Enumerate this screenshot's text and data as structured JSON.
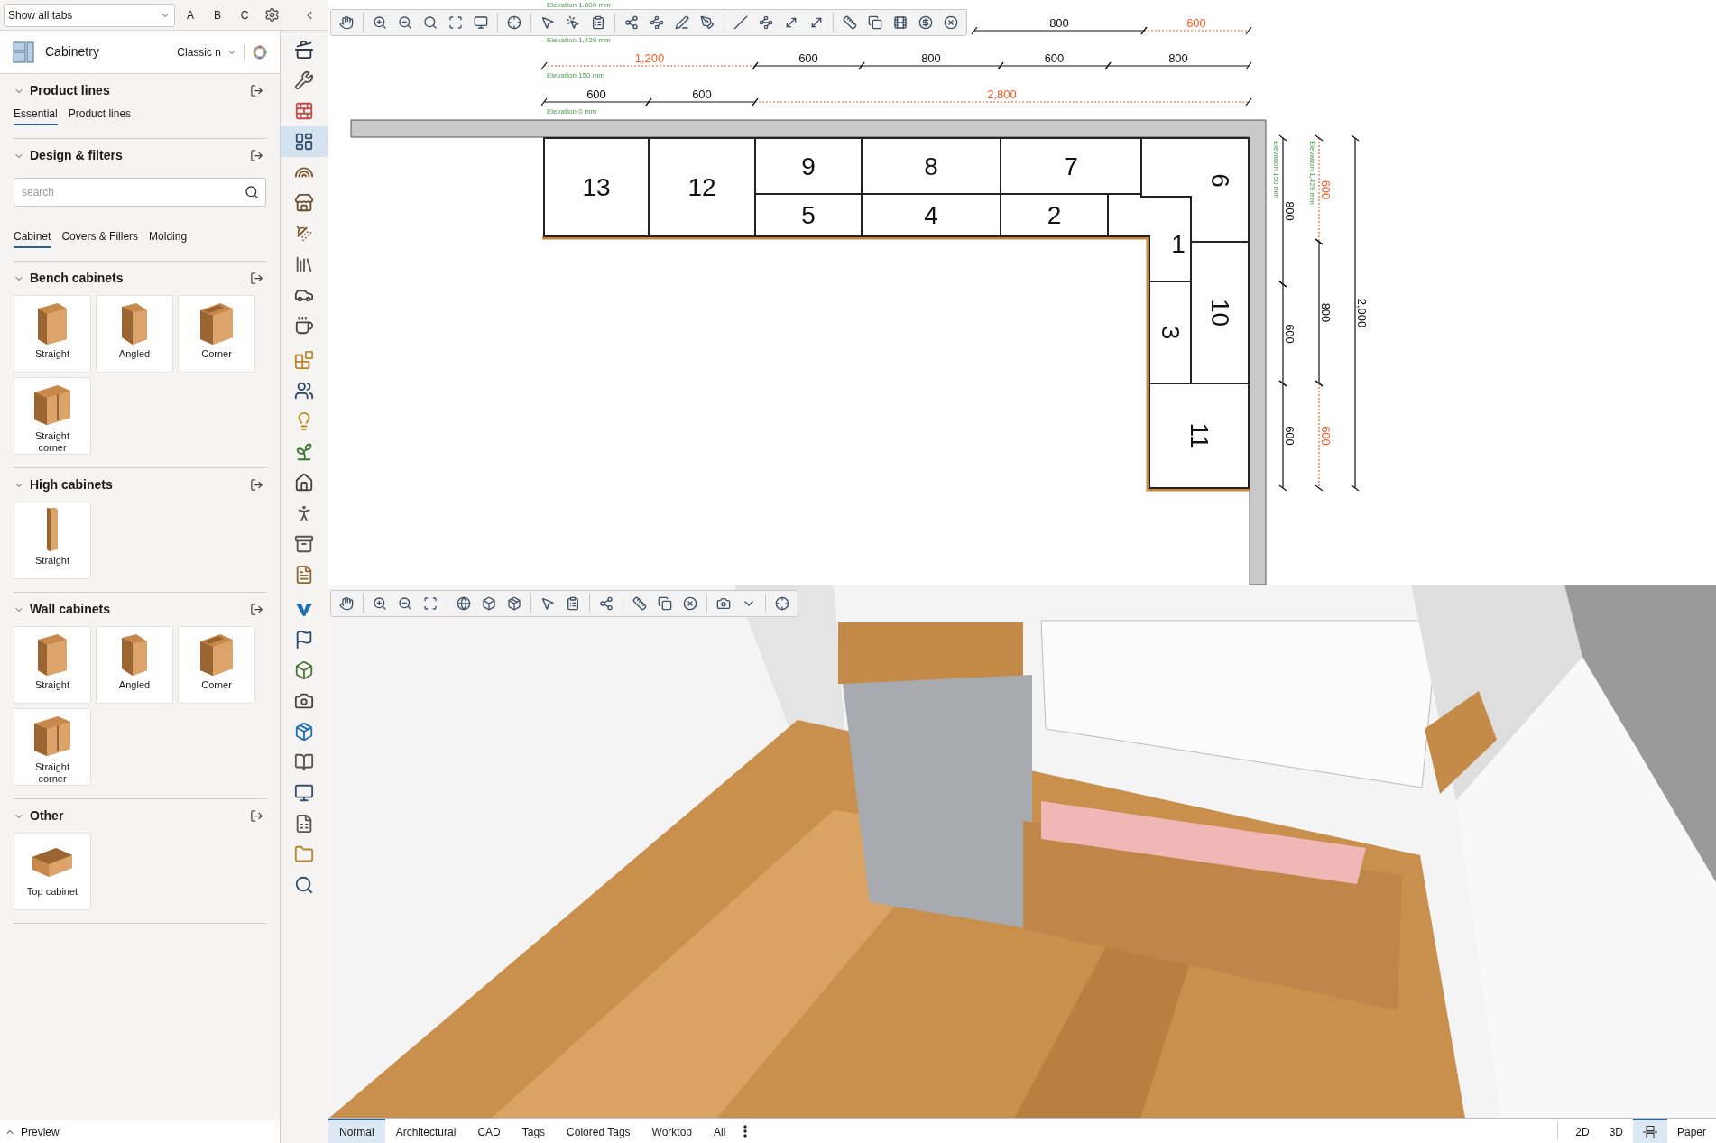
{
  "top_bar": {
    "tab_filter": "Show all tabs",
    "letters": [
      "A",
      "B",
      "C"
    ]
  },
  "catalog": {
    "title": "Cabinetry",
    "style": "Classic n"
  },
  "sections": [
    {
      "title": "Product lines",
      "expanded": true,
      "tabs": [
        {
          "label": "Essential",
          "selected": true
        },
        {
          "label": "Product lines",
          "selected": false
        }
      ]
    },
    {
      "title": "Design & filters",
      "expanded": true,
      "search": {
        "placeholder": "search"
      },
      "tabs": [
        {
          "label": "Cabinet",
          "selected": true
        },
        {
          "label": "Covers & Fillers",
          "selected": false
        },
        {
          "label": "Molding",
          "selected": false
        }
      ]
    },
    {
      "title": "Bench cabinets",
      "expanded": true,
      "items": [
        {
          "label": "Straight",
          "kind": "straight"
        },
        {
          "label": "Angled",
          "kind": "angled"
        },
        {
          "label": "Corner",
          "kind": "corner"
        },
        {
          "label": "Straight corner",
          "kind": "straight_corner"
        }
      ]
    },
    {
      "title": "High cabinets",
      "expanded": true,
      "items": [
        {
          "label": "Straight",
          "kind": "tall"
        }
      ]
    },
    {
      "title": "Wall cabinets",
      "expanded": true,
      "items": [
        {
          "label": "Straight",
          "kind": "straight"
        },
        {
          "label": "Angled",
          "kind": "angled"
        },
        {
          "label": "Corner",
          "kind": "corner"
        },
        {
          "label": "Straight corner",
          "kind": "straight_corner"
        }
      ]
    },
    {
      "title": "Other",
      "expanded": true,
      "items": [
        {
          "label": "Top cabinet",
          "kind": "top"
        }
      ]
    }
  ],
  "preview": {
    "label": "Preview",
    "expanded": false
  },
  "tools": [
    {
      "selected": false
    },
    {
      "selected": false
    },
    {
      "selected": false
    },
    {
      "selected": true
    },
    {
      "selected": false
    },
    {
      "selected": false
    },
    {
      "selected": false
    },
    {
      "selected": false
    },
    {
      "selected": false
    },
    {
      "selected": false
    },
    {
      "selected": false
    },
    {
      "selected": false
    },
    {
      "selected": false
    },
    {
      "selected": false
    },
    {
      "selected": false
    },
    {
      "selected": false
    },
    {
      "selected": false
    },
    {
      "selected": false
    },
    {
      "selected": false
    },
    {
      "selected": false
    },
    {
      "selected": false
    },
    {
      "selected": false
    },
    {
      "selected": false
    },
    {
      "selected": false
    },
    {
      "selected": false
    },
    {
      "selected": false
    },
    {
      "selected": false
    },
    {
      "selected": false
    }
  ],
  "plan": {
    "top_elevation": "Elevation 1,800 mm",
    "dimension_rows": [
      {
        "elevation": "Elevation 1,429 mm",
        "segments": [
          {
            "label": "800",
            "highlighted": false
          },
          {
            "label": "600",
            "highlighted": true
          }
        ]
      },
      {
        "elevation": "Elevation 150 mm",
        "segments": [
          {
            "label": "1,200",
            "highlighted": true
          },
          {
            "label": "600",
            "highlighted": false
          },
          {
            "label": "800",
            "highlighted": false
          },
          {
            "label": "600",
            "highlighted": false
          },
          {
            "label": "800",
            "highlighted": false
          }
        ]
      },
      {
        "elevation": "Elevation 0 mm",
        "segments": [
          {
            "label": "600",
            "highlighted": false
          },
          {
            "label": "600",
            "highlighted": false
          },
          {
            "label": "2,800",
            "highlighted": true
          }
        ]
      }
    ],
    "vertical_dimensions": [
      {
        "elevation": "Elevation 150 mm",
        "segments": [
          {
            "label": "800",
            "highlighted": false
          },
          {
            "label": "600",
            "highlighted": false
          },
          {
            "label": "600",
            "highlighted": false
          }
        ]
      },
      {
        "elevation": "Elevation 1,429 mm",
        "segments": [
          {
            "label": "600",
            "highlighted": true
          },
          {
            "label": "800",
            "highlighted": false
          },
          {
            "label": "600",
            "highlighted": true
          }
        ]
      },
      {
        "segments": [
          {
            "label": "2,000",
            "highlighted": false
          }
        ]
      }
    ],
    "cabinets": [
      {
        "number": "13"
      },
      {
        "number": "12"
      },
      {
        "number": "9"
      },
      {
        "number": "5"
      },
      {
        "number": "8"
      },
      {
        "number": "4"
      },
      {
        "number": "7"
      },
      {
        "number": "2"
      },
      {
        "number": "6"
      },
      {
        "number": "1"
      },
      {
        "number": "10"
      },
      {
        "number": "3"
      },
      {
        "number": "11"
      }
    ]
  },
  "view_modes": [
    {
      "label": "Normal",
      "selected": true
    },
    {
      "label": "Architectural",
      "selected": false
    },
    {
      "label": "CAD",
      "selected": false
    },
    {
      "label": "Tags",
      "selected": false
    },
    {
      "label": "Colored Tags",
      "selected": false
    },
    {
      "label": "Worktop",
      "selected": false
    },
    {
      "label": "All",
      "selected": false
    }
  ],
  "views": [
    {
      "kind": "text",
      "label": "2D",
      "selected": false
    },
    {
      "kind": "text",
      "label": "3D",
      "selected": false
    },
    {
      "kind": "split",
      "selected": true
    },
    {
      "kind": "text",
      "label": "Paper",
      "selected": false
    }
  ]
}
